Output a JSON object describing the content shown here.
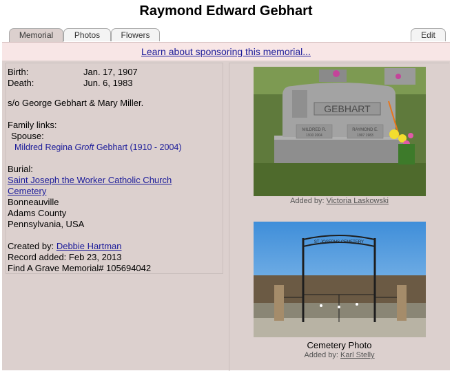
{
  "title": "Raymond Edward Gebhart",
  "tabs": [
    "Memorial",
    "Photos",
    "Flowers"
  ],
  "edit_tab": "Edit",
  "sponsor_text": "Learn about sponsoring this memorial...",
  "birth": {
    "label": "Birth:",
    "value": "Jan. 17, 1907"
  },
  "death": {
    "label": "Death:",
    "value": "Jun. 6, 1983"
  },
  "parents": "s/o George Gebhart & Mary Miller.",
  "family": {
    "heading": "Family links:",
    "spouse_label": "Spouse:",
    "spouse_first": "Mildred Regina ",
    "spouse_maiden": "Groft",
    "spouse_last": " Gebhart (1910 - 2004)"
  },
  "burial": {
    "label": "Burial:",
    "cemetery_line1": "Saint Joseph the Worker Catholic Church",
    "cemetery_line2": "Cemetery",
    "city": "Bonneauville",
    "county": "Adams County",
    "state": "Pennsylvania, USA"
  },
  "created_by_label": "Created by: ",
  "created_by": "Debbie Hartman",
  "record_added": "Record added: Feb 23, 2013",
  "memorial_id": "Find A Grave Memorial# 105694042",
  "photo1": {
    "added_by_label": "Added by: ",
    "added_by": "Victoria Laskowski",
    "stone_name": "GEBHART",
    "stone_left": "MILDRED R.",
    "stone_left_dates": "1910    2004",
    "stone_right": "RAYMOND E.",
    "stone_right_dates": "1907    1983"
  },
  "photo2": {
    "caption": "Cemetery Photo",
    "added_by_label": "Added by: ",
    "added_by": "Karl Stelly",
    "gate_sign": "ST JOSEPHS CEMETERY"
  },
  "colors": {
    "content_bg": "#dcd0ce",
    "sponsor_bg": "#f8e6e6",
    "link": "#1a1a99"
  }
}
